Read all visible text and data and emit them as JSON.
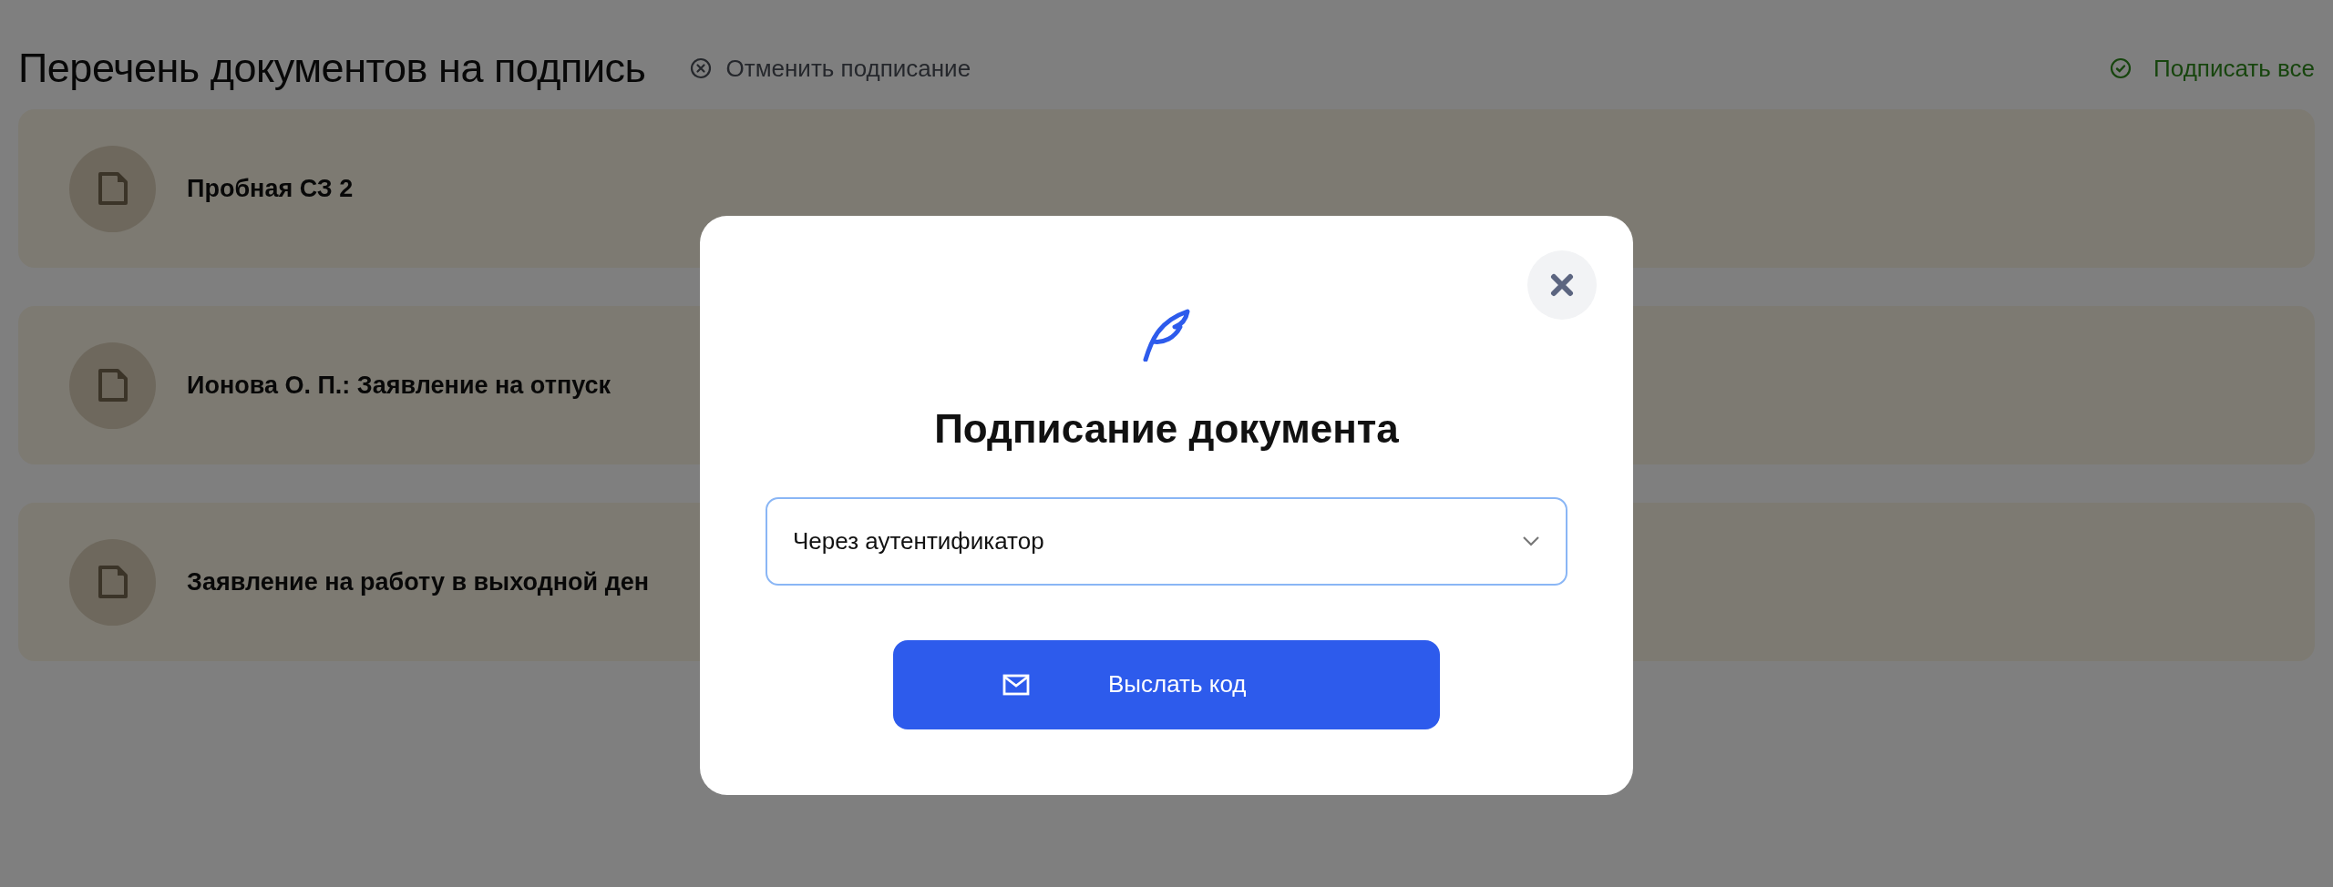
{
  "page": {
    "title": "Перечень документов на подпись",
    "cancel_link": "Отменить подписание",
    "sign_all_link": "Подписать все"
  },
  "documents": [
    {
      "title": "Пробная СЗ 2"
    },
    {
      "title": "Ионова О. П.: Заявление на отпуск"
    },
    {
      "title": "Заявление на работу в выходной ден"
    }
  ],
  "modal": {
    "title": "Подписание документа",
    "method_select": {
      "value": "Через аутентификатор"
    },
    "send_button": "Выслать код"
  }
}
